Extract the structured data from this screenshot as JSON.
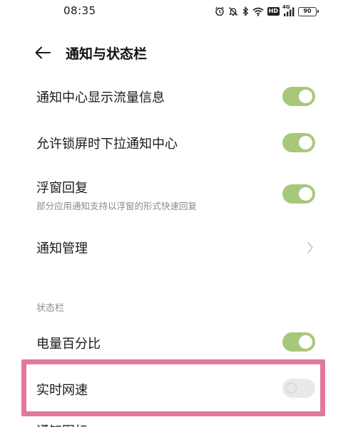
{
  "status_bar": {
    "time": "08:35",
    "icons": [
      "alarm-icon",
      "mute-icon",
      "bluetooth-icon",
      "wifi-icon",
      "hd-icon",
      "signal-icon",
      "battery-icon"
    ],
    "hd_label": "HD",
    "network_label": "4G",
    "battery_level": "90"
  },
  "header": {
    "title": "通知与状态栏"
  },
  "settings": {
    "traffic_info": {
      "label": "通知中心显示流量信息",
      "enabled": true
    },
    "lockscreen_pulldown": {
      "label": "允许锁屏时下拉通知中心",
      "enabled": true
    },
    "floating_reply": {
      "label": "浮窗回复",
      "subtitle": "部分应用通知支持以浮窗的形式快速回复",
      "enabled": true
    },
    "notification_management": {
      "label": "通知管理"
    }
  },
  "statusbar_section": {
    "title": "状态栏",
    "battery_percentage": {
      "label": "电量百分比",
      "enabled": true
    },
    "realtime_speed": {
      "label": "实时网速",
      "enabled": false
    },
    "next_item_partial": {
      "label": "通知图标"
    }
  },
  "colors": {
    "toggle_on": "#a7c87a",
    "toggle_off": "#e9e9e9",
    "highlight": "#e2799c"
  }
}
